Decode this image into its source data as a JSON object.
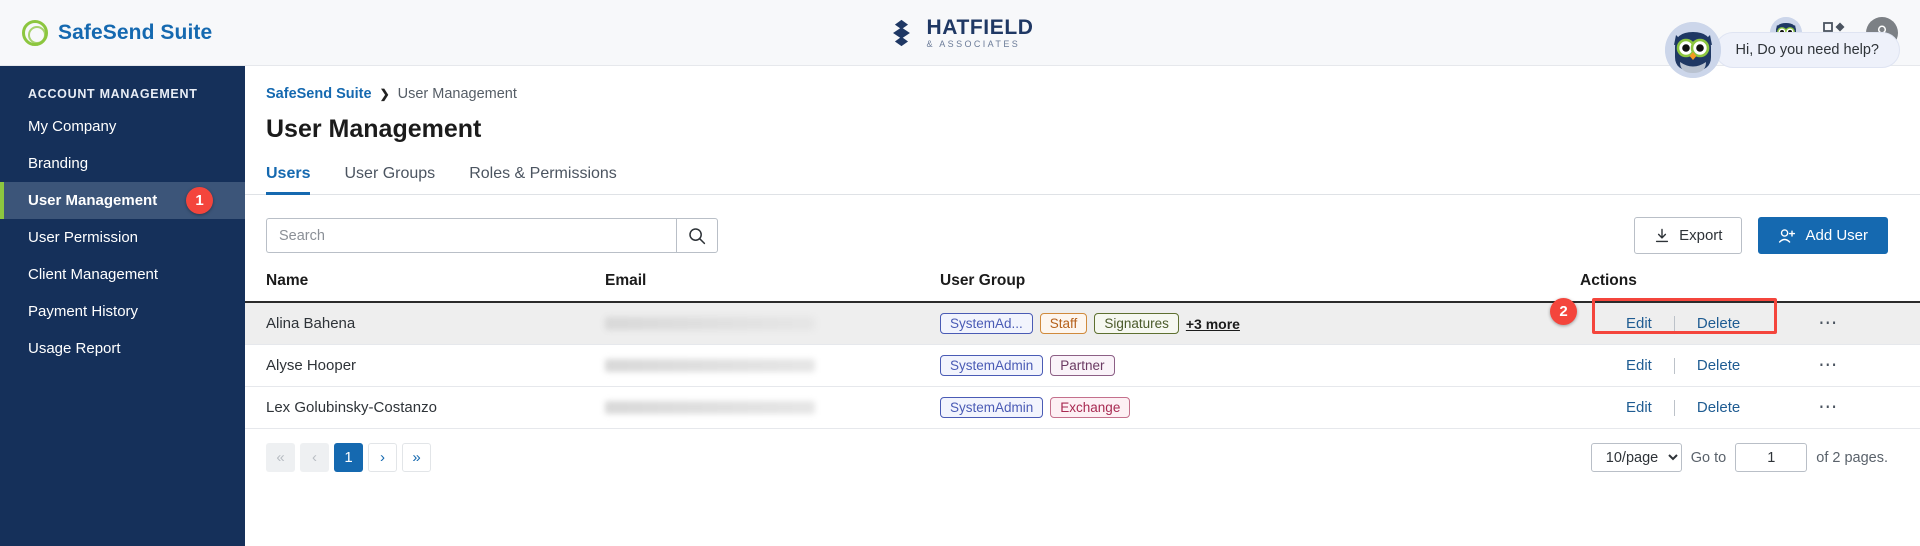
{
  "topbar": {
    "brand_name": "SafeSend Suite",
    "brand_icon": "safesend-ring-icon",
    "company_logo_name": "HATFIELD",
    "company_logo_sub": "& ASSOCIATES",
    "company_logo_icon": "hatfield-diamond-icon",
    "owl_icon": "owl-assistant-icon",
    "apps_icon": "apps-grid-icon",
    "profile_icon": "user-profile-icon"
  },
  "sidebar": {
    "section_title": "ACCOUNT MANAGEMENT",
    "items": [
      {
        "label": "My Company",
        "active": false
      },
      {
        "label": "Branding",
        "active": false
      },
      {
        "label": "User Management",
        "active": true,
        "badge": "1"
      },
      {
        "label": "User Permission",
        "active": false
      },
      {
        "label": "Client Management",
        "active": false
      },
      {
        "label": "Payment History",
        "active": false
      },
      {
        "label": "Usage Report",
        "active": false
      }
    ]
  },
  "breadcrumb": {
    "root": "SafeSend Suite",
    "separator": "❯",
    "current": "User Management"
  },
  "page": {
    "title": "User Management"
  },
  "tabs": [
    {
      "label": "Users",
      "active": true
    },
    {
      "label": "User Groups",
      "active": false
    },
    {
      "label": "Roles & Permissions",
      "active": false
    }
  ],
  "toolbar": {
    "search_placeholder": "Search",
    "search_value": "",
    "search_icon": "search-icon",
    "export_label": "Export",
    "export_icon": "download-icon",
    "add_user_label": "Add User",
    "add_user_icon": "user-plus-icon"
  },
  "table": {
    "headers": {
      "name": "Name",
      "email": "Email",
      "user_group": "User Group",
      "actions": "Actions"
    },
    "rows": [
      {
        "name": "Alina Bahena",
        "email": "",
        "email_redacted": true,
        "highlighted": true,
        "tags": [
          {
            "label": "SystemAd...",
            "color": "blue"
          },
          {
            "label": "Staff",
            "color": "orange"
          },
          {
            "label": "Signatures",
            "color": "green"
          }
        ],
        "more_label": "+3 more",
        "edit_label": "Edit",
        "delete_label": "Delete",
        "overflow_icon": "ellipsis-icon",
        "annotation_badge": "2"
      },
      {
        "name": "Alyse Hooper",
        "email": "",
        "email_redacted": true,
        "highlighted": false,
        "tags": [
          {
            "label": "SystemAdmin",
            "color": "blue"
          },
          {
            "label": "Partner",
            "color": "purple"
          }
        ],
        "more_label": "",
        "edit_label": "Edit",
        "delete_label": "Delete",
        "overflow_icon": "ellipsis-icon"
      },
      {
        "name": "Lex Golubinsky-Costanzo",
        "email": "",
        "email_redacted": true,
        "highlighted": false,
        "tags": [
          {
            "label": "SystemAdmin",
            "color": "blue"
          },
          {
            "label": "Exchange",
            "color": "pink"
          }
        ],
        "more_label": "",
        "edit_label": "Edit",
        "delete_label": "Delete",
        "overflow_icon": "ellipsis-icon"
      }
    ]
  },
  "pagination": {
    "first_label": "«",
    "prev_label": "‹",
    "current_page": "1",
    "next_label": "›",
    "last_label": "»",
    "per_page_value": "10/page",
    "goto_label": "Go to",
    "goto_value": "1",
    "total_label": "of 2 pages."
  },
  "help": {
    "message": "Hi, Do you need help?",
    "owl_icon": "owl-assistant-icon"
  },
  "colors": {
    "accent_blue": "#1569b0",
    "sidebar_bg": "#15305a",
    "active_green": "#8cc63f",
    "annotation_red": "#f4453c"
  }
}
